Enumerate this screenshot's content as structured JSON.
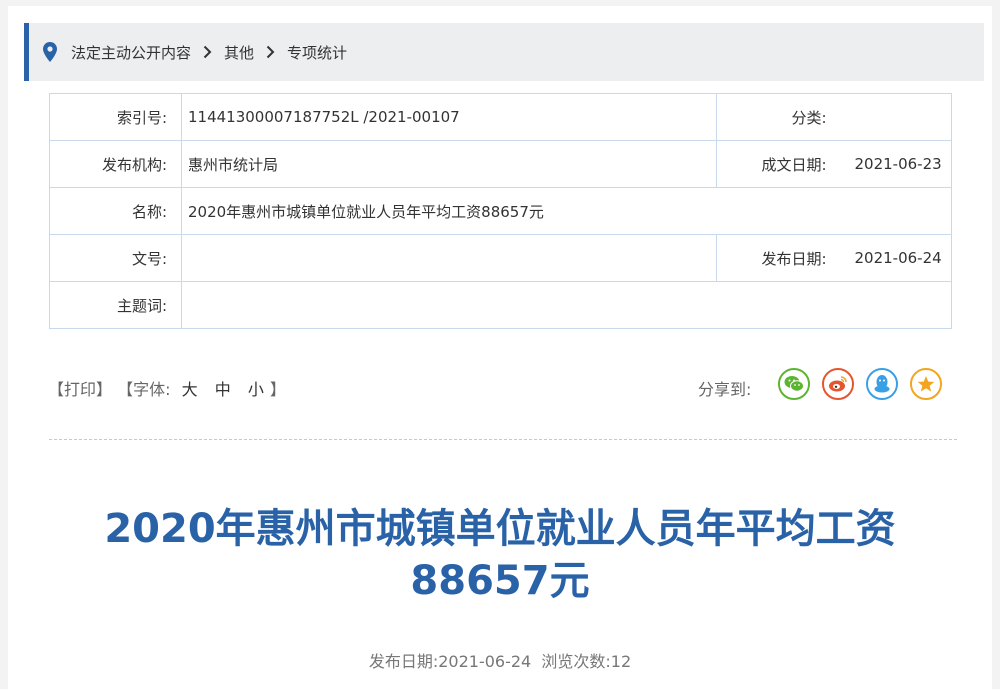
{
  "breadcrumb": {
    "items": [
      "法定主动公开内容",
      "其他",
      "专项统计"
    ]
  },
  "meta": {
    "index_label": "索引号:",
    "index_value": "11441300007187752L  /2021-00107",
    "category_label": "分类:",
    "category_value": "",
    "publisher_label": "发布机构:",
    "publisher_value": "惠州市统计局",
    "created_label": "成文日期:",
    "created_value": "2021-06-23",
    "name_label": "名称:",
    "name_value": "2020年惠州市城镇单位就业人员年平均工资88657元",
    "docno_label": "文号:",
    "docno_value": "",
    "pubdate_label": "发布日期:",
    "pubdate_value": "2021-06-24",
    "subject_label": "主题词:",
    "subject_value": ""
  },
  "tools": {
    "print": "【打印】",
    "font_prefix": "【字体:",
    "font_large": "大",
    "font_medium": "中",
    "font_small": "小",
    "font_suffix": "】",
    "share_label": "分享到:"
  },
  "share_icons": [
    {
      "name": "wechat-icon",
      "color": "#5cb531"
    },
    {
      "name": "weibo-icon",
      "color": "#e5552f"
    },
    {
      "name": "qq-icon",
      "color": "#39a0e6"
    },
    {
      "name": "qzone-icon",
      "color": "#f3a51d"
    }
  ],
  "article": {
    "title_line1": "2020年惠州市城镇单位就业人员年平均工资",
    "title_line2": "88657元",
    "pubdate_label": "发布日期:",
    "pubdate_value": "2021-06-24",
    "views_label": "浏览次数:",
    "views_value": "12"
  },
  "colors": {
    "accent": "#2a62a8",
    "border": "#c7d9ea"
  }
}
